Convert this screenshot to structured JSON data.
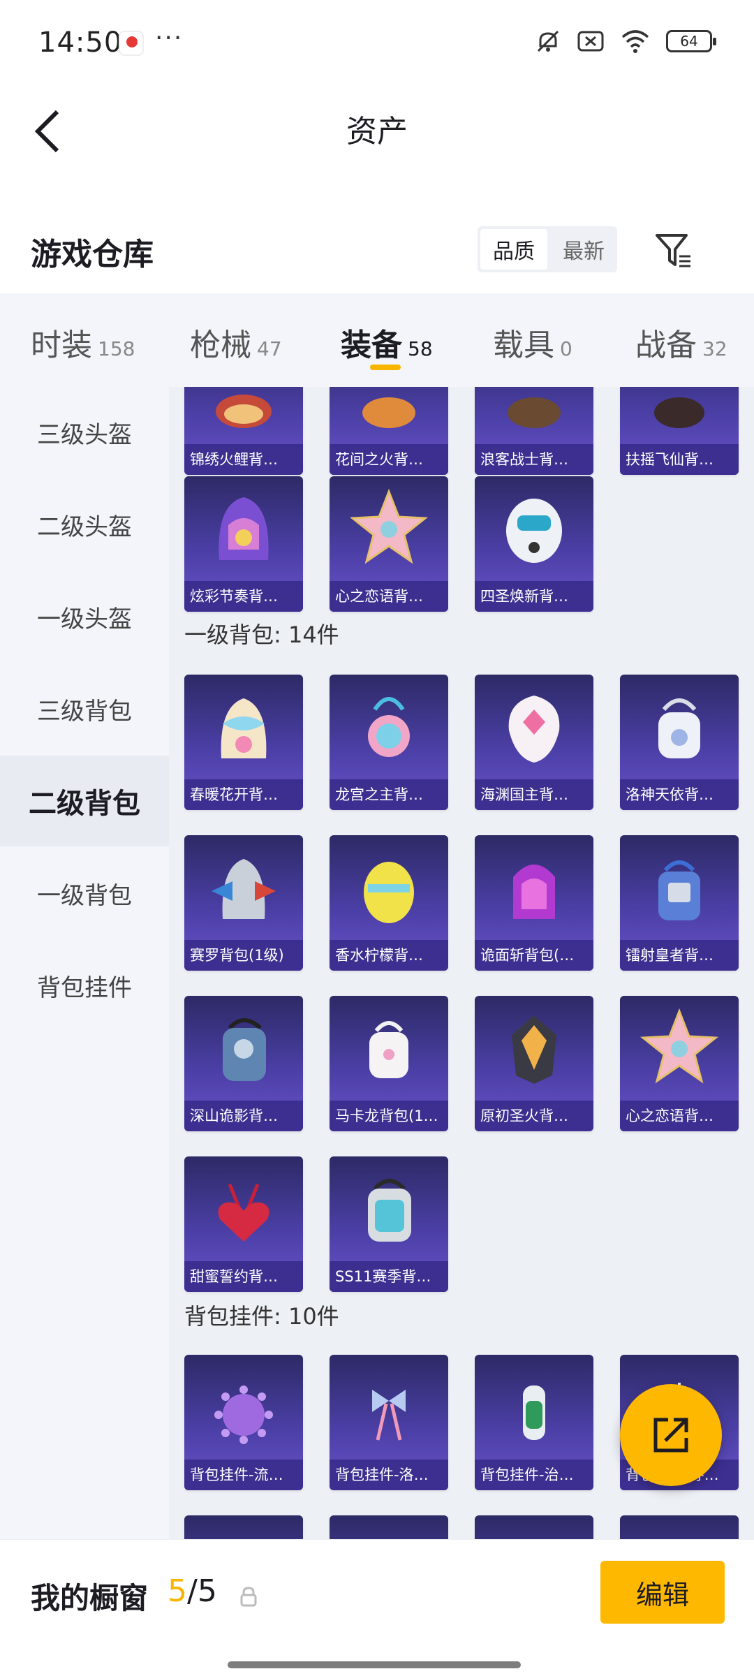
{
  "status": {
    "time": "14:50",
    "more": "···",
    "battery": "64"
  },
  "header": {
    "title": "资产"
  },
  "warehouse": {
    "title": "游戏仓库",
    "sort_options": [
      "品质",
      "最新"
    ]
  },
  "tabs": [
    {
      "label": "时装",
      "count": "158"
    },
    {
      "label": "枪械",
      "count": "47"
    },
    {
      "label": "装备",
      "count": "58"
    },
    {
      "label": "载具",
      "count": "0"
    },
    {
      "label": "战备",
      "count": "32"
    }
  ],
  "side_menu": [
    "三级头盔",
    "二级头盔",
    "一级头盔",
    "三级背包",
    "二级背包",
    "一级背包",
    "背包挂件"
  ],
  "sections": {
    "lv1_backpack": "一级背包: 14件",
    "pendant": "背包挂件: 10件"
  },
  "items": {
    "row_top": [
      "锦绣火鲤背…",
      "花间之火背…",
      "浪客战士背…",
      "扶摇飞仙背…"
    ],
    "row_lv2": [
      "炫彩节奏背…",
      "心之恋语背…",
      "四圣焕新背…"
    ],
    "lv1_row1": [
      "春暖花开背…",
      "龙宫之主背…",
      "海渊国主背…",
      "洛神天依背…"
    ],
    "lv1_row2": [
      "赛罗背包(1级)",
      "香水柠檬背…",
      "诡面斩背包(…",
      "镭射皇者背…"
    ],
    "lv1_row3": [
      "深山诡影背…",
      "马卡龙背包(1…",
      "原初圣火背…",
      "心之恋语背…"
    ],
    "lv1_row4": [
      "甜蜜誓约背…",
      "SS11赛季背…"
    ],
    "pendant_row1": [
      "背包挂件-流…",
      "背包挂件-洛…",
      "背包挂件-治…",
      "背包挂件-寻…"
    ]
  },
  "bottom": {
    "title": "我的橱窗",
    "current": "5",
    "separator": "/",
    "max": "5",
    "edit": "编辑"
  },
  "colors": {
    "accent": "#ffb800",
    "card_top": "#2d2a66",
    "card_bottom": "#6a52c9"
  }
}
